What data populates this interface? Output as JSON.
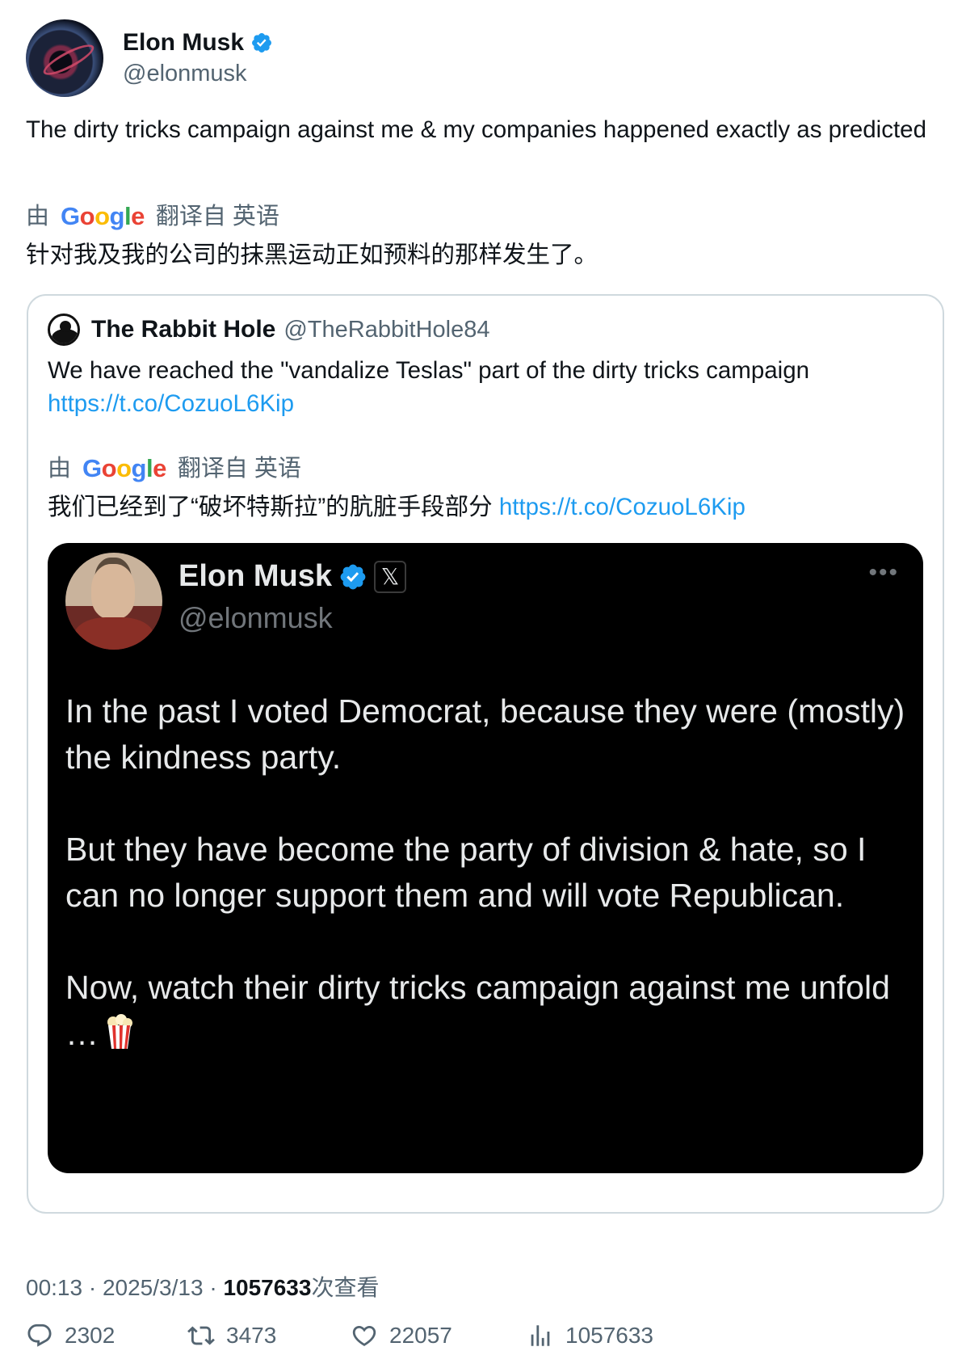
{
  "author": {
    "display_name": "Elon Musk",
    "handle": "@elonmusk"
  },
  "tweet": {
    "text": "The dirty tricks campaign against me & my companies happened exactly as predicted",
    "translate_prefix": "由",
    "translate_suffix": "翻译自 英语",
    "translated_text": "针对我及我的公司的抹黑运动正如预料的那样发生了。"
  },
  "quote": {
    "display_name": "The Rabbit Hole",
    "handle": "@TheRabbitHole84",
    "text": "We have reached the \"vandalize Teslas\" part of the dirty tricks campaign",
    "link": "https://t.co/CozuoL6Kip",
    "translate_prefix": "由",
    "translate_suffix": "翻译自 英语",
    "translated_text": "我们已经到了“破坏特斯拉”的肮脏手段部分",
    "translated_link": "https://t.co/CozuoL6Kip"
  },
  "media": {
    "display_name": "Elon Musk",
    "handle": "@elonmusk",
    "x_badge": "𝕏",
    "more": "•••",
    "paragraph_1": "In the past I voted Democrat, because they were (mostly) the kindness party.",
    "paragraph_2": "But they have become the party of division & hate, so I can no longer support them and will vote Republican.",
    "paragraph_3": "Now, watch their dirty tricks campaign against me unfold …"
  },
  "meta": {
    "time": "00:13",
    "date": "2025/3/13",
    "views": "1057633",
    "views_suffix": "次查看"
  },
  "actions": {
    "replies": "2302",
    "reposts": "3473",
    "likes": "22057",
    "views": "1057633"
  },
  "colors": {
    "accent": "#1d9bf0",
    "secondary_text": "#536471",
    "border": "#cfd9de"
  },
  "icons": [
    "verified-badge-icon",
    "google-logo",
    "x-logo-icon",
    "more-icon",
    "popcorn-icon",
    "reply-icon",
    "repost-icon",
    "like-icon",
    "views-icon"
  ]
}
